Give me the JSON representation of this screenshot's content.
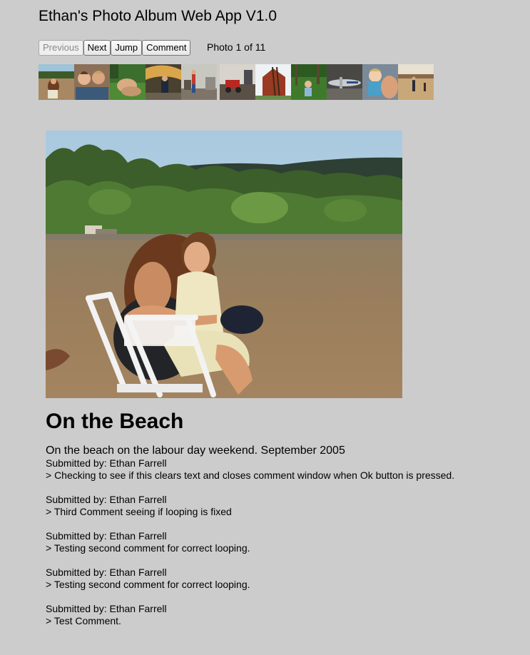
{
  "app": {
    "title": "Ethan's Photo Album Web App V1.0"
  },
  "controls": {
    "previous_label": "Previous",
    "next_label": "Next",
    "jump_label": "Jump",
    "comment_label": "Comment",
    "previous_enabled": false
  },
  "counter": {
    "text": "Photo 1 of 11",
    "current": 1,
    "total": 11
  },
  "thumbnails": [
    {
      "name": "thumb-beach",
      "scene": "beach"
    },
    {
      "name": "thumb-couch",
      "scene": "couch"
    },
    {
      "name": "thumb-nap",
      "scene": "nap"
    },
    {
      "name": "thumb-boat",
      "scene": "boat"
    },
    {
      "name": "thumb-living-room",
      "scene": "living-room"
    },
    {
      "name": "thumb-workshop",
      "scene": "workshop"
    },
    {
      "name": "thumb-barn",
      "scene": "barn"
    },
    {
      "name": "thumb-toddler-grass",
      "scene": "grass"
    },
    {
      "name": "thumb-airplane",
      "scene": "airplane"
    },
    {
      "name": "thumb-baby",
      "scene": "baby"
    },
    {
      "name": "thumb-gym",
      "scene": "gym"
    }
  ],
  "photo": {
    "title": "On the Beach",
    "caption": "On the beach on the labour day weekend. September 2005"
  },
  "comments": [
    {
      "submitted_by": "Submitted by: Ethan Farrell",
      "text": "> Checking to see if this clears text and closes comment window when Ok button is pressed."
    },
    {
      "submitted_by": "Submitted by: Ethan Farrell",
      "text": "> Third Comment seeing if looping is fixed"
    },
    {
      "submitted_by": "Submitted by: Ethan Farrell",
      "text": "> Testing second comment for correct looping."
    },
    {
      "submitted_by": "Submitted by: Ethan Farrell",
      "text": "> Testing second comment for correct looping."
    },
    {
      "submitted_by": "Submitted by: Ethan Farrell",
      "text": "> Test Comment."
    }
  ],
  "colors": {
    "page_background": "#cccccc",
    "text": "#000000"
  }
}
